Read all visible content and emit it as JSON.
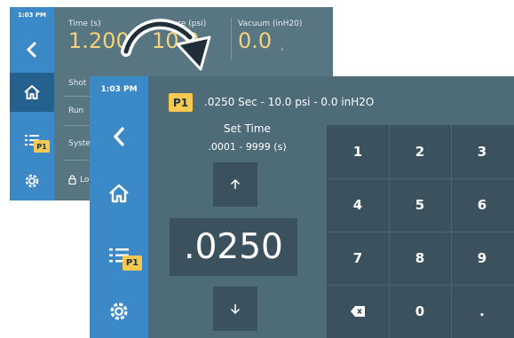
{
  "back": {
    "time": "1:03 PM",
    "params": [
      {
        "label": "Time (s)",
        "value": "1.200"
      },
      {
        "label": "Pressure (psi)",
        "value": "10.0"
      },
      {
        "label": "Vacuum (inH20)",
        "value": "0.0"
      }
    ],
    "menu": [
      "Shot",
      "Run",
      "Syste"
    ],
    "lock_label": "Lo",
    "badge": "P1"
  },
  "front": {
    "time": "1:03 PM",
    "program_badge": "P1",
    "summary": ".0250 Sec - 10.0 psi - 0.0 inH2O",
    "set_title": "Set Time",
    "range": ".0001 - 9999 (s)",
    "value": ".0250",
    "sidebar_badge": "P1",
    "keys": [
      "1",
      "2",
      "3",
      "4",
      "5",
      "6",
      "7",
      "8",
      "9",
      "backspace",
      "0",
      "."
    ]
  },
  "colors": {
    "sidebar": "#3b8ac7",
    "screen_bg": "#4e6b78",
    "keypad_bg": "#3b515e",
    "accent": "#f7c950"
  }
}
